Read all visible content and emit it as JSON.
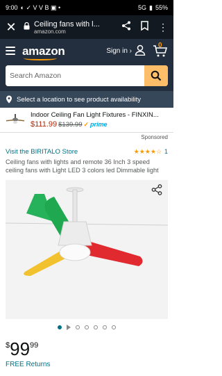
{
  "status_bar": {
    "time": "9:00",
    "left_icons": "◐ ✓ V V B ▣ •",
    "right_text": "5G",
    "battery": "55%"
  },
  "browser": {
    "tab_title": "Ceiling fans with l...",
    "domain": "amazon.com"
  },
  "header": {
    "logo": "amazon",
    "signin": "Sign in ›",
    "cart_count": "0"
  },
  "search": {
    "placeholder": "Search Amazon"
  },
  "location": {
    "text": "Select a location to see product availability"
  },
  "ad": {
    "title": "Indoor Ceiling Fan Light Fixtures - FINXIN...",
    "price": "$111.99",
    "list_price": "$139.99",
    "prime": "prime"
  },
  "sponsored": "Sponsored",
  "product": {
    "store_link": "Visit the BIRITALO Store",
    "stars": "★★★★☆",
    "rating_count": "1",
    "title": "Ceiling fans with lights and remote 36 Inch 3 speed ceiling fans with Light LED 3 colors led Dimmable light",
    "price_symbol": "$",
    "price_whole": "99",
    "price_fraction": "99",
    "free_returns": "FREE Returns"
  },
  "gallery": {
    "image_count": 7,
    "active_index": 0
  },
  "colors": {
    "amazon_dark": "#131921",
    "amazon_header": "#232f3e",
    "location_bar": "#37475a",
    "search_button": "#febd69",
    "link": "#007185",
    "accent": "#ff9900"
  }
}
